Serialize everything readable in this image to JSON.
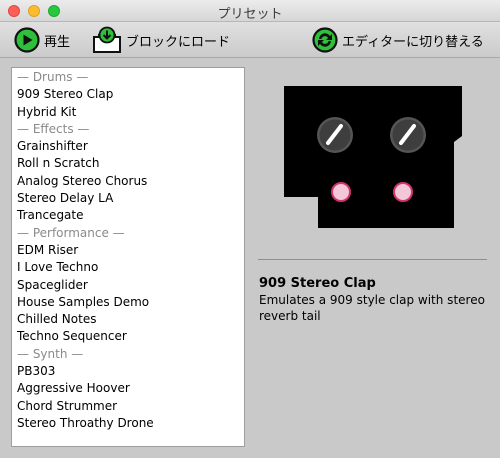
{
  "window": {
    "title": "プリセット"
  },
  "toolbar": {
    "play_label": "再生",
    "load_label": "ブロックにロード",
    "switch_label": "エディターに切り替える"
  },
  "preset_list": {
    "rows": [
      {
        "text": "— Drums —",
        "kind": "header"
      },
      {
        "text": "909 Stereo Clap",
        "kind": "item"
      },
      {
        "text": "Hybrid Kit",
        "kind": "item"
      },
      {
        "text": "— Effects —",
        "kind": "header"
      },
      {
        "text": "Grainshifter",
        "kind": "item"
      },
      {
        "text": "Roll n Scratch",
        "kind": "item"
      },
      {
        "text": "Analog Stereo Chorus",
        "kind": "item"
      },
      {
        "text": "Stereo Delay LA",
        "kind": "item"
      },
      {
        "text": "Trancegate",
        "kind": "item"
      },
      {
        "text": "— Performance —",
        "kind": "header"
      },
      {
        "text": "EDM Riser",
        "kind": "item"
      },
      {
        "text": "I Love Techno",
        "kind": "item"
      },
      {
        "text": "Spaceglider",
        "kind": "item"
      },
      {
        "text": "House Samples Demo",
        "kind": "item"
      },
      {
        "text": "Chilled Notes",
        "kind": "item"
      },
      {
        "text": "Techno Sequencer",
        "kind": "item"
      },
      {
        "text": "— Synth —",
        "kind": "header"
      },
      {
        "text": "PB303",
        "kind": "item"
      },
      {
        "text": "Aggressive Hoover",
        "kind": "item"
      },
      {
        "text": "Chord Strummer",
        "kind": "item"
      },
      {
        "text": "Stereo Throathy Drone",
        "kind": "item"
      }
    ]
  },
  "detail": {
    "name": "909 Stereo Clap",
    "description": "Emulates a 909 style clap with stereo reverb tail"
  },
  "icons": {
    "play": "play-icon",
    "load": "load-to-block-icon",
    "switch": "switch-editor-icon",
    "knob": "knob-icon",
    "pad": "pad-icon"
  },
  "colors": {
    "play_green": "#2fbf3a",
    "pad_ring": "#d2336e",
    "pad_fill": "#f3c7d6",
    "block_bg": "#000000"
  }
}
